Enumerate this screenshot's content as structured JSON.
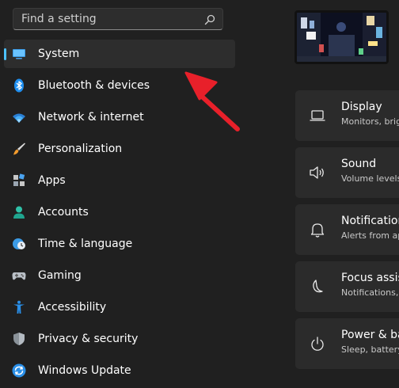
{
  "search": {
    "placeholder": "Find a setting"
  },
  "sidebar": {
    "items": [
      {
        "label": "System",
        "icon": "monitor-icon",
        "selected": true
      },
      {
        "label": "Bluetooth & devices",
        "icon": "bluetooth-icon"
      },
      {
        "label": "Network & internet",
        "icon": "wifi-icon"
      },
      {
        "label": "Personalization",
        "icon": "brush-icon"
      },
      {
        "label": "Apps",
        "icon": "apps-icon"
      },
      {
        "label": "Accounts",
        "icon": "person-icon"
      },
      {
        "label": "Time & language",
        "icon": "globe-clock-icon"
      },
      {
        "label": "Gaming",
        "icon": "gamepad-icon"
      },
      {
        "label": "Accessibility",
        "icon": "accessibility-icon"
      },
      {
        "label": "Privacy & security",
        "icon": "shield-icon"
      },
      {
        "label": "Windows Update",
        "icon": "update-icon"
      }
    ]
  },
  "system_page": {
    "cards": [
      {
        "title": "Display",
        "subtitle": "Monitors, brig",
        "icon": "laptop-icon"
      },
      {
        "title": "Sound",
        "subtitle": "Volume levels",
        "icon": "speaker-icon"
      },
      {
        "title": "Notification",
        "subtitle": "Alerts from ap",
        "icon": "bell-icon"
      },
      {
        "title": "Focus assist",
        "subtitle": "Notifications,",
        "icon": "moon-icon"
      },
      {
        "title": "Power & bat",
        "subtitle": "Sleep, battery",
        "icon": "power-icon"
      }
    ]
  },
  "colors": {
    "accent": "#4cc2ff",
    "background": "#202020",
    "card": "#2b2b2b",
    "selected": "#2d2d2d",
    "arrow": "#e8202a"
  }
}
